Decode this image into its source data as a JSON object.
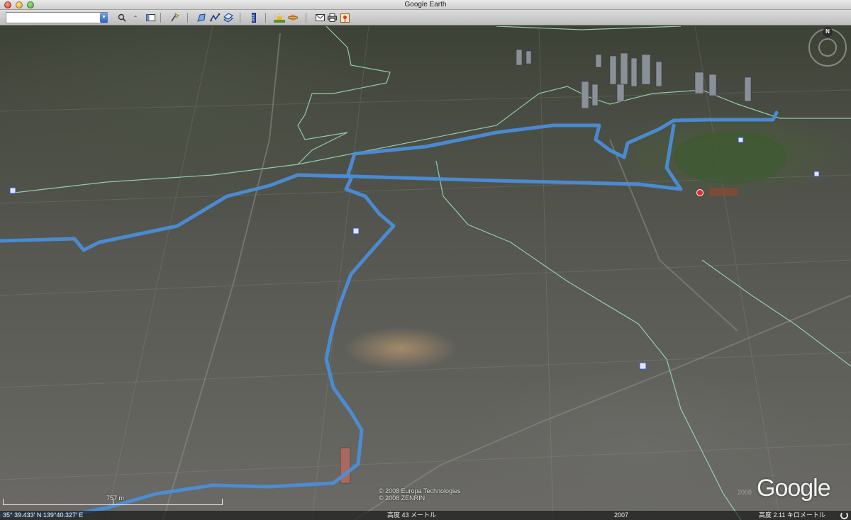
{
  "window": {
    "title": "Google Earth"
  },
  "toolbar": {
    "search_value": "",
    "buttons": [
      "search-icon",
      "caret-icon",
      "sidebar-icon",
      "placemark-icon",
      "polygon-icon",
      "path-icon",
      "overlay-icon",
      "ruler-icon",
      "sun-icon",
      "planet-icon",
      "email-icon",
      "print-icon",
      "maps-icon"
    ]
  },
  "map": {
    "compass_label": "N",
    "copyright": [
      "© 2008 Europa Technologies",
      "© 2008 ZENRIN"
    ],
    "logo": "Google",
    "scale_label": "757 m",
    "faint_date": "2008"
  },
  "status": {
    "coordinates": "35° 39.433' N  139°40.327' E",
    "elevation": "高度  43 メートル",
    "imagery_date": "2007",
    "eye_alt": "高度  2.11 キロメートル"
  },
  "colors": {
    "route": "#4a8fdc",
    "boundary": "#9fe0c0"
  }
}
